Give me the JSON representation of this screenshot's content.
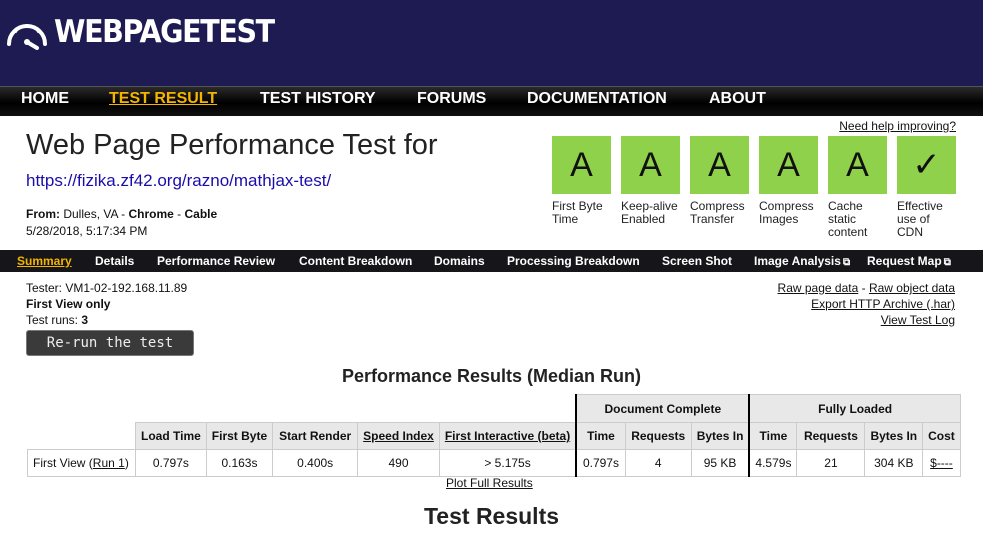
{
  "brand": {
    "logo_text": "WEBPAGETEST",
    "logo_icon": "speedometer-icon"
  },
  "nav": [
    {
      "label": "HOME",
      "active": false
    },
    {
      "label": "TEST RESULT",
      "active": true
    },
    {
      "label": "TEST HISTORY",
      "active": false
    },
    {
      "label": "FORUMS",
      "active": false
    },
    {
      "label": "DOCUMENTATION",
      "active": false
    },
    {
      "label": "ABOUT",
      "active": false
    }
  ],
  "title": "Web Page Performance Test for",
  "url": "https://fizika.zf42.org/razno/mathjax-test/",
  "from": {
    "label": "From:",
    "location": "Dulles, VA",
    "browser": "Chrome",
    "connection": "Cable",
    "sep": " - "
  },
  "date": "5/28/2018, 5:17:34 PM",
  "help_link": "Need help improving?",
  "grades": [
    {
      "grade": "A",
      "label": "First Byte Time"
    },
    {
      "grade": "A",
      "label": "Keep-alive Enabled"
    },
    {
      "grade": "A",
      "label": "Compress Transfer"
    },
    {
      "grade": "A",
      "label": "Compress Images"
    },
    {
      "grade": "A",
      "label": "Cache static content"
    },
    {
      "grade": "✓",
      "label": "Effective use of CDN"
    }
  ],
  "grade_color": "#8fd14a",
  "subnav": [
    {
      "label": "Summary",
      "active": true,
      "external": false
    },
    {
      "label": "Details",
      "active": false,
      "external": false
    },
    {
      "label": "Performance Review",
      "active": false,
      "external": false
    },
    {
      "label": "Content Breakdown",
      "active": false,
      "external": false
    },
    {
      "label": "Domains",
      "active": false,
      "external": false
    },
    {
      "label": "Processing Breakdown",
      "active": false,
      "external": false
    },
    {
      "label": "Screen Shot",
      "active": false,
      "external": false
    },
    {
      "label": "Image Analysis",
      "active": false,
      "external": true
    },
    {
      "label": "Request Map",
      "active": false,
      "external": true
    }
  ],
  "info": {
    "tester": "Tester: VM1-02-192.168.11.89",
    "view": "First View only",
    "runs_label": "Test runs: ",
    "runs_value": "3"
  },
  "rerun_button": "Re-run the test",
  "links": {
    "raw_page": "Raw page data",
    "link_sep": " - ",
    "raw_object": "Raw object data",
    "export_har": "Export HTTP Archive (.har)",
    "test_log": "View Test Log"
  },
  "perf_title": "Performance Results (Median Run)",
  "table": {
    "group_document": "Document Complete",
    "group_fully": "Fully Loaded",
    "headers": [
      "Load Time",
      "First Byte",
      "Start Render",
      "Speed Index",
      "First Interactive (beta)",
      "Time",
      "Requests",
      "Bytes In",
      "Time",
      "Requests",
      "Bytes In",
      "Cost"
    ],
    "row": {
      "label": "First View (",
      "run_link": "Run 1",
      "label_end": ")",
      "values": [
        "0.797s",
        "0.163s",
        "0.400s",
        "490",
        "> 5.175s",
        "0.797s",
        "4",
        "95 KB",
        "4.579s",
        "21",
        "304 KB"
      ],
      "cost": "$----"
    }
  },
  "plot_link": "Plot Full Results",
  "test_results_heading": "Test Results"
}
